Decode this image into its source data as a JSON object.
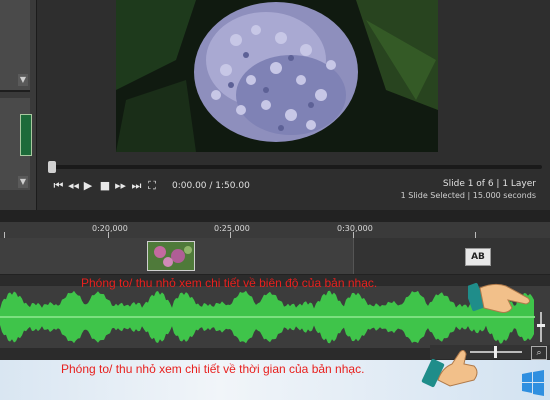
{
  "preview": {
    "time_readout": "0:00.00 / 1:50.00",
    "slide_info": "Slide 1 of 6  |  1 Layer",
    "selection_info": "1 Slide Selected  |  15.000 seconds",
    "playback_progress": 0
  },
  "controls": [
    {
      "name": "skip-to-start-icon",
      "glyph": "⏮"
    },
    {
      "name": "rewind-icon",
      "glyph": "◀◀"
    },
    {
      "name": "play-icon",
      "glyph": "▶"
    },
    {
      "name": "stop-icon",
      "glyph": "■"
    },
    {
      "name": "fast-forward-icon",
      "glyph": "▶▶"
    },
    {
      "name": "skip-to-end-icon",
      "glyph": "⏭"
    },
    {
      "name": "fullscreen-icon",
      "glyph": "⛶"
    }
  ],
  "timeline": {
    "ruler_labels": [
      "0:20,000",
      "0:25,000",
      "0:30,000"
    ],
    "caption_label": "AB"
  },
  "annotations": {
    "amplitude": "Phóng to/ thu nhỏ xem chi tiết về biên độ của bản nhạc.",
    "time": "Phóng to/ thu nhỏ xem chi tiết về thời gian của bản nhạc."
  },
  "colors": {
    "waveform": "#3fc44a",
    "annotation": "#e8201e",
    "hand": "#f2c08a",
    "cuff": "#1f8d8a"
  }
}
